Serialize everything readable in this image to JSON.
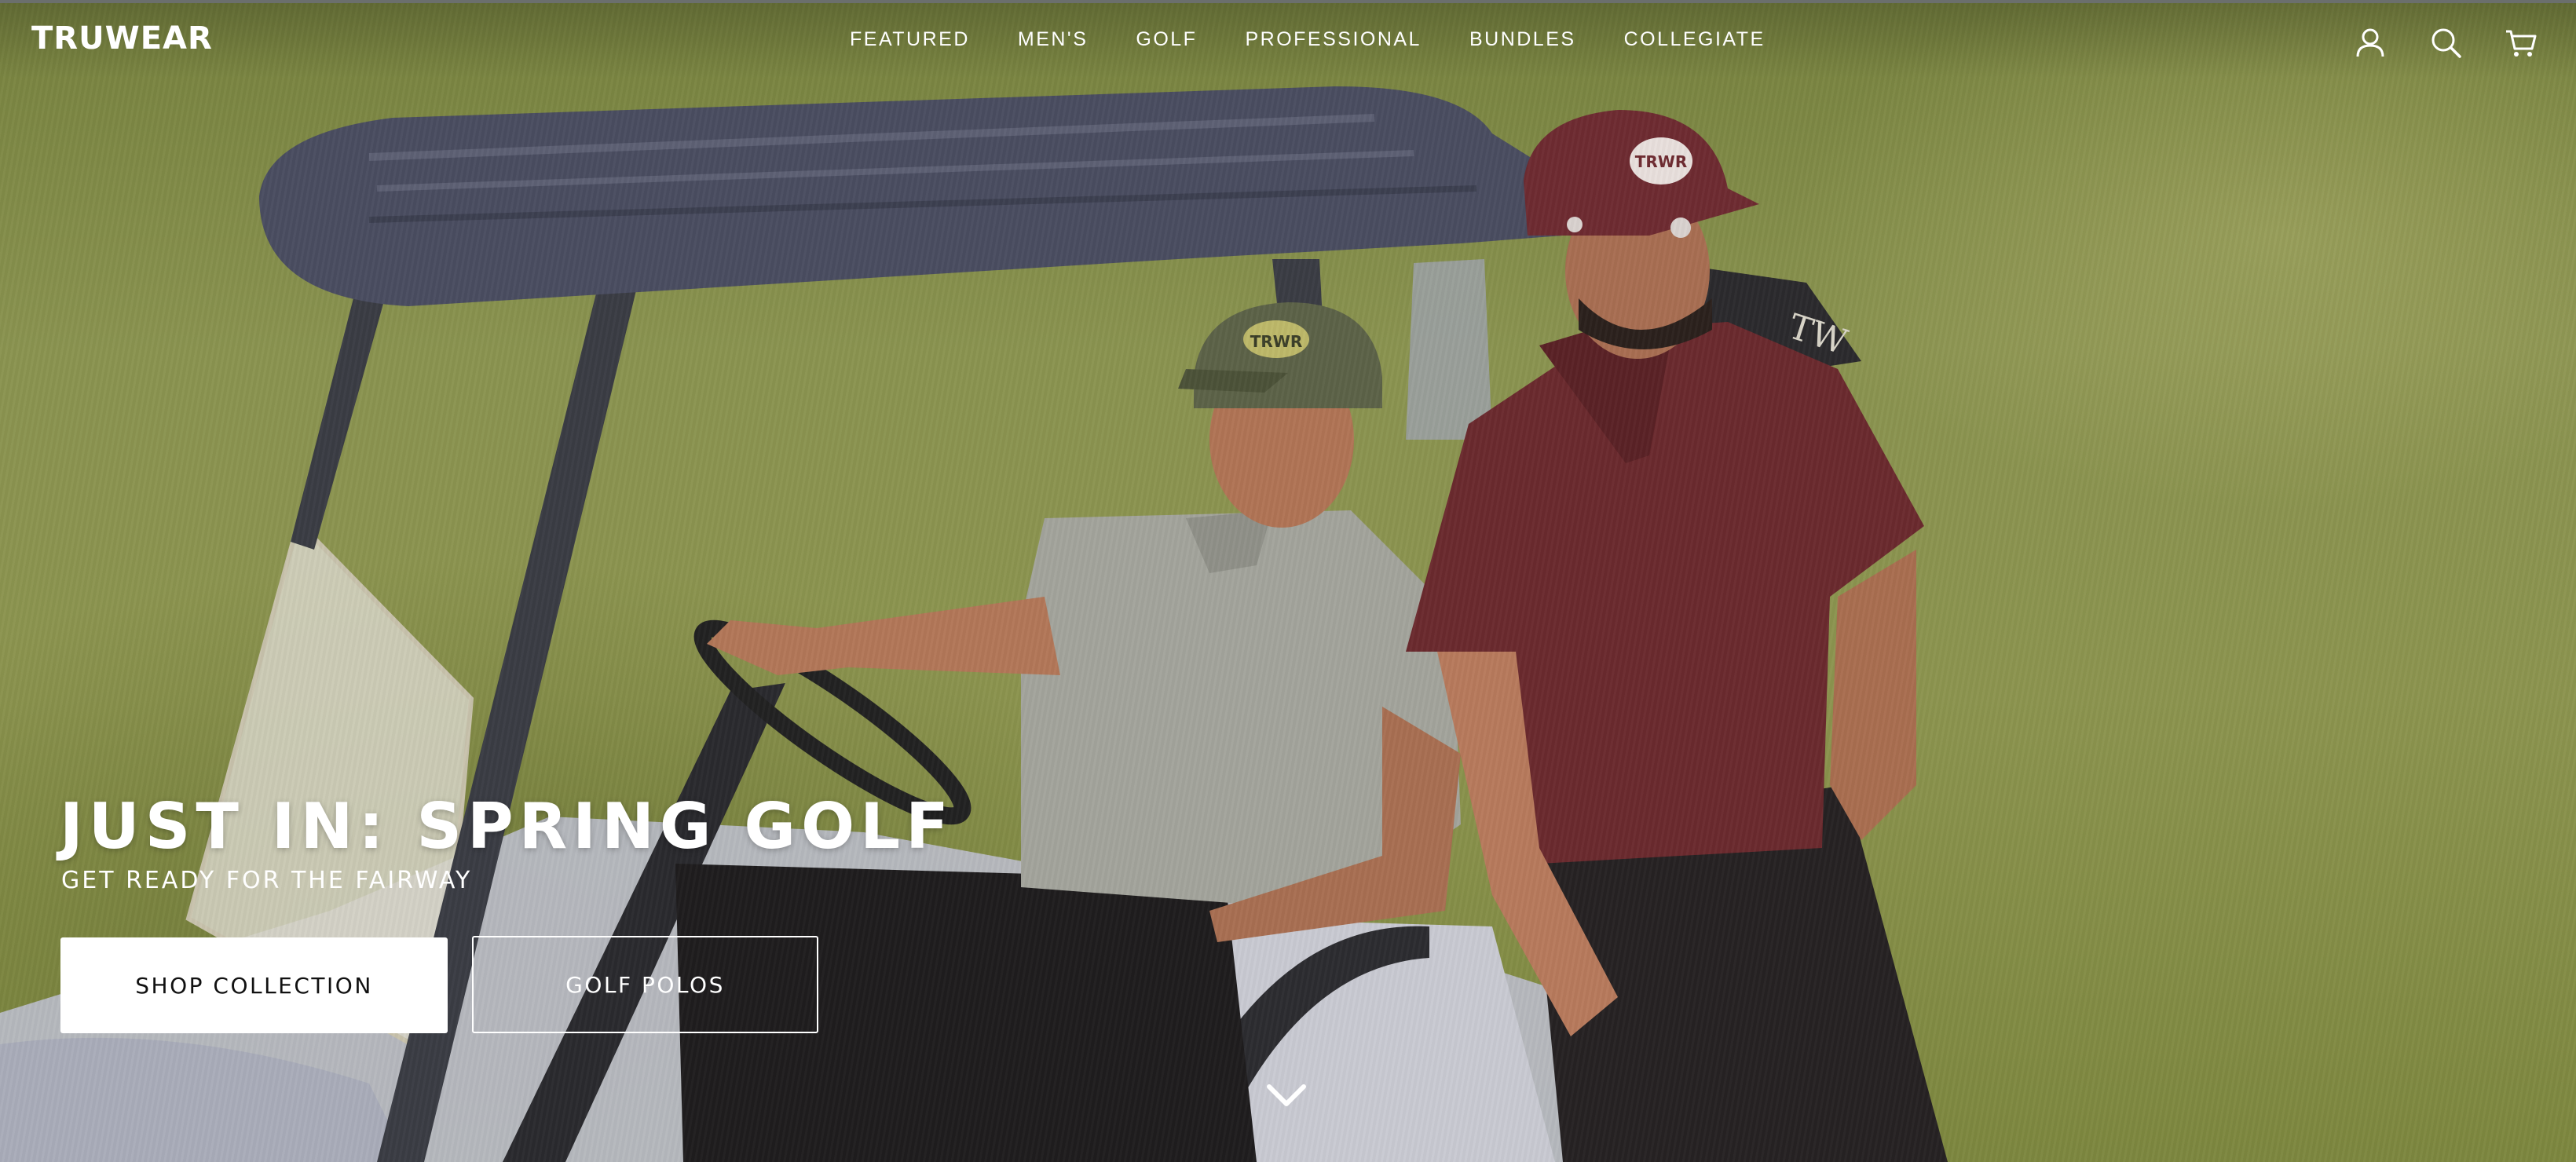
{
  "brand": {
    "logo": "TRUWEAR"
  },
  "nav": {
    "items": [
      {
        "label": "FEATURED"
      },
      {
        "label": "MEN'S"
      },
      {
        "label": "GOLF"
      },
      {
        "label": "PROFESSIONAL"
      },
      {
        "label": "BUNDLES"
      },
      {
        "label": "COLLEGIATE"
      }
    ]
  },
  "header_icons": [
    "account-icon",
    "search-icon",
    "cart-icon"
  ],
  "hero": {
    "headline": "JUST IN: SPRING GOLF",
    "subhead": "GET READY FOR THE FAIRWAY",
    "primary_cta": "SHOP COLLECTION",
    "secondary_cta": "GOLF POLOS",
    "hat_left_text": "TRWR",
    "hat_right_text": "TRWR",
    "bag_text": "TW"
  },
  "colors": {
    "grass": "#8a9350",
    "cart_roof": "#4a4d60",
    "maroon_shirt": "#6b2a2e",
    "grey_polo": "#a3a49c",
    "olive_cap": "#5c6248"
  }
}
